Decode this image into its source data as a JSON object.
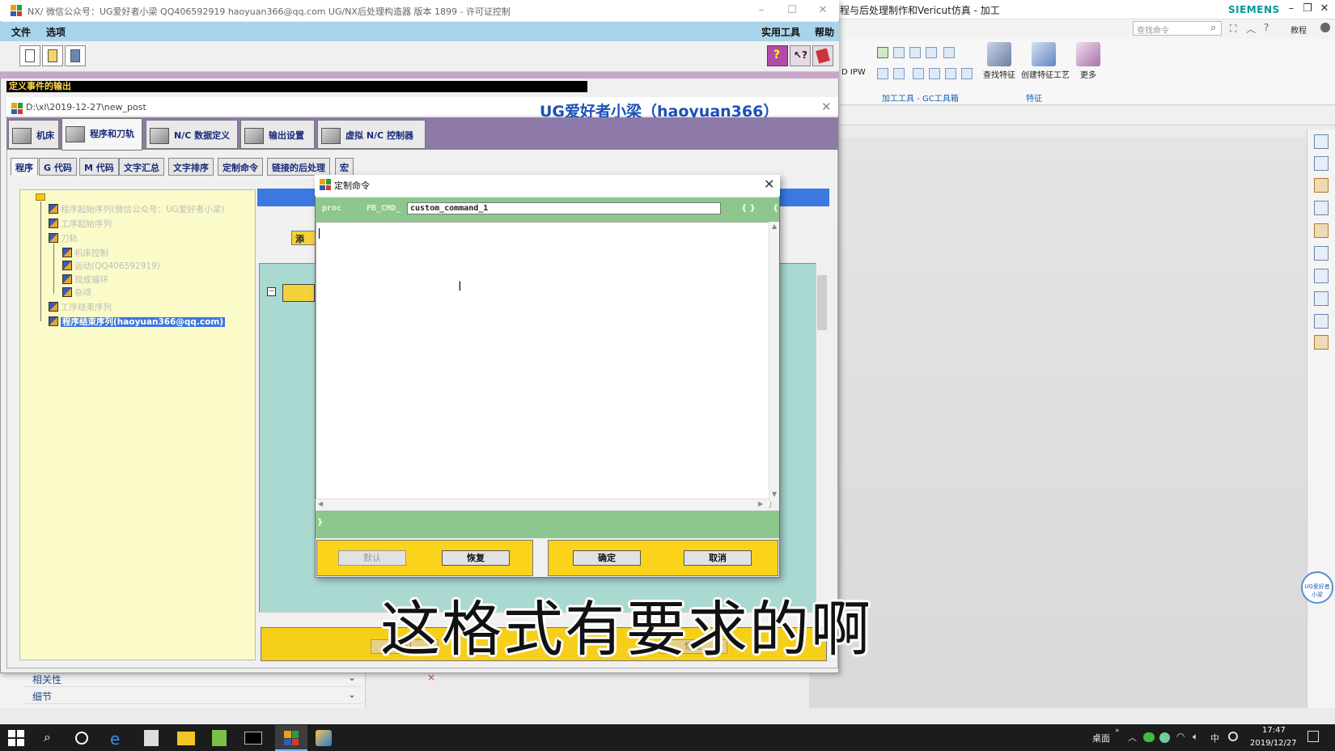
{
  "nx": {
    "title": "程与后处理制作和Vericut仿真 - 加工",
    "brand": "SIEMENS",
    "search_placeholder": "查找命令",
    "tutorial": "教程",
    "ribbon": {
      "ipw": "D IPW",
      "find_feature": "查找特征",
      "create_feature_process": "创建特征工艺",
      "more": "更多",
      "group_tools": "加工工具 - GC工具箱",
      "group_feature": "特征"
    },
    "left_panel": {
      "related": "相关性",
      "details": "细节"
    },
    "logo_badge": "UG爱好者小梁"
  },
  "pb": {
    "title": "NX/  微信公众号：UG爱好者小梁  QQ406592919  haoyuan366@qq.com  UG/NX后处理构造器 版本 1899 - 许可证控制",
    "menu": {
      "file": "文件",
      "options": "选项",
      "utilities": "实用工具",
      "help": "帮助"
    },
    "status": "定义事件的输出",
    "path": "D:\\xl\\2019-12-27\\new_post",
    "watermark": "UG爱好者小梁（haoyuan366）",
    "main_tabs": [
      "机床",
      "程序和刀轨",
      "N/C 数据定义",
      "输出设置",
      "虚拟 N/C 控制器"
    ],
    "sub_tabs": [
      "程序",
      "G 代码",
      "M 代码",
      "文字汇总",
      "文字排序",
      "定制命令",
      "链接的后处理",
      "宏"
    ],
    "tree": [
      "程序起始序列(微信公众号：UG爱好者小梁)",
      "工序起始序列",
      "刀轨",
      "机床控制",
      "运动(QQ406592919)",
      "现成循环",
      "杂项",
      "工序结束序列",
      "程序结束序列(haoyuan366@qq.com)"
    ],
    "add_label": "添",
    "ghost_buttons": {
      "default": "默认",
      "restore": "恢复"
    }
  },
  "dialog": {
    "title": "定制命令",
    "proc": "proc",
    "prefix": "PB_CMD_",
    "name_value": "custom_command_1",
    "braces": "{ }",
    "brace_open": "{",
    "brace_close": "}",
    "buttons": {
      "default": "默认",
      "restore": "恢复",
      "ok": "确定",
      "cancel": "取消"
    }
  },
  "subtitle": "这格式有要求的啊",
  "taskbar": {
    "desktop": "桌面",
    "ime": "中",
    "time": "17:47",
    "date": "2019/12/27"
  }
}
